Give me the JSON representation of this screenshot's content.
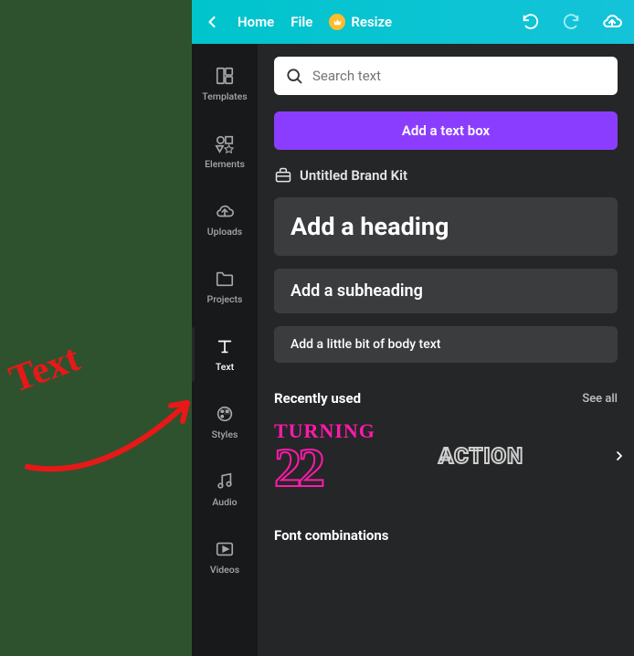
{
  "annotation": {
    "text": "Text"
  },
  "toolbar": {
    "home": "Home",
    "file": "File",
    "resize": "Resize"
  },
  "sidebar": {
    "templates": "Templates",
    "elements": "Elements",
    "uploads": "Uploads",
    "projects": "Projects",
    "text": "Text",
    "styles": "Styles",
    "audio": "Audio",
    "videos": "Videos"
  },
  "panel": {
    "search_placeholder": "Search text",
    "add_text_box": "Add a text box",
    "brand_kit": "Untitled Brand Kit",
    "heading": "Add a heading",
    "subheading": "Add a subheading",
    "body": "Add a little bit of body text",
    "recently_used": "Recently used",
    "see_all": "See all",
    "card1_top": "TURNING",
    "card1_num": "22",
    "card2": "ACTION",
    "font_combinations": "Font combinations"
  }
}
